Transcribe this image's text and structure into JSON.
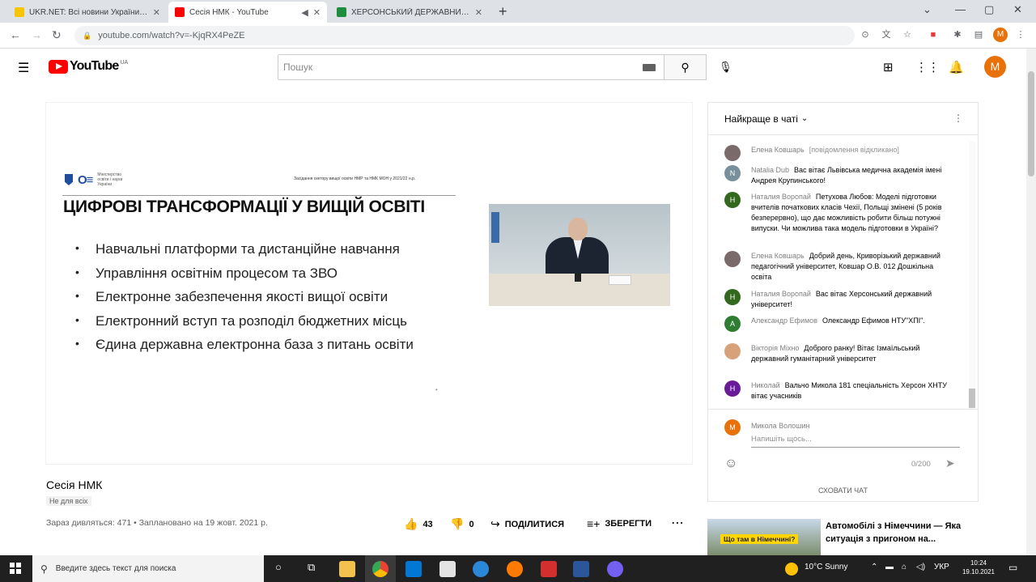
{
  "browser": {
    "tabs": [
      {
        "title": "UKR.NET: Всі новини України, о",
        "favicon_color": "#f7c600"
      },
      {
        "title": "Сесія НМК - YouTube",
        "favicon_color": "#ff0000"
      },
      {
        "title": "ХЕРСОНСЬКИЙ ДЕРЖАВНИЙ УН",
        "favicon_color": "#1e8e3e"
      }
    ],
    "url": "youtube.com/watch?v=-KjqRX4PeZE",
    "profile_initial": "M"
  },
  "youtube": {
    "logo_text": "YouTube",
    "country": "UA",
    "search_placeholder": "Пошук",
    "avatar_initial": "M"
  },
  "slide": {
    "header_note": "Засідання сектору вищої освіти НМР та НМК МОН у 2021/22 н.р.",
    "org_small": "Міністерство освіти і науки України",
    "title": "ЦИФРОВІ ТРАНСФОРМАЦІЇ У ВИЩІЙ ОСВІТІ",
    "bullets": [
      "Навчальні платформи та дистанційне навчання",
      "Управління освітнім процесом та ЗВО",
      "Електронне забезпечення якості вищої освіти",
      "Електронний вступ та розподіл бюджетних місць",
      "Єдина державна електронна база з питань освіти"
    ]
  },
  "video": {
    "title": "Сесія НМК",
    "badge": "Не для всіх",
    "info": "Зараз дивляться: 471 • Заплановано на 19 жовт. 2021 р.",
    "likes": "43",
    "dislikes": "0",
    "share_label": "ПОДІЛИТИСЯ",
    "save_label": "ЗБЕРЕГТИ"
  },
  "chat": {
    "header": "Найкраще в чаті",
    "messages": [
      {
        "author": "Елена Ковшарь",
        "text": "[повідомлення відкликано]",
        "initial": "",
        "color": "#7a6a6a"
      },
      {
        "author": "Natalia Dub",
        "text": "Вас вітає Львівська медична академія імені Андрея Крупинського!",
        "initial": "N",
        "color": "#78909c"
      },
      {
        "author": "Наталия Воропай",
        "text": "Петухова Любов: Моделі підготовки вчителів початкових класів Чехії, Польщі змінені (5 років безперервно), що дає можливість робити більш потужні випуски. Чи можлива така модель підготовки в Україні?",
        "initial": "Н",
        "color": "#33691e"
      },
      {
        "author": "Елена Ковшарь",
        "text": "Добрий день, Криворізький державний педагогічний університет, Ковшар О.В. 012 Дошкільна освіта",
        "initial": "",
        "color": "#7a6a6a"
      },
      {
        "author": "Наталия Воропай",
        "text": "Вас вітає Херсонський державний університет!",
        "initial": "Н",
        "color": "#33691e"
      },
      {
        "author": "Александр Ефимов",
        "text": "Олександр Ефимов НТУ\"ХПІ\".",
        "initial": "А",
        "color": "#2e7d32"
      },
      {
        "author": "Вікторія Міхно",
        "text": "Доброго ранку! Вітає Ізмаїльський державний гуманітарний університет",
        "initial": "",
        "color": "#d7a27a"
      },
      {
        "author": "Николай",
        "text": "Вальчо Микола 181 спеціальність Херсон ХНТУ вітає учасників",
        "initial": "Н",
        "color": "#6a1b9a"
      }
    ],
    "composer_name": "Микола Волошин",
    "composer_initial": "M",
    "composer_placeholder": "Напишіть щось...",
    "char_count": "0/200",
    "hide_label": "СХОВАТИ ЧАТ"
  },
  "recommended": {
    "title": "Автомобілі з Німеччини ― Яка ситуація з пригоном на...",
    "thumb_caption": "Що там в Німеччині?"
  },
  "taskbar": {
    "search_placeholder": "Введите здесь текст для поиска",
    "weather": "10°C  Sunny",
    "lang": "УКР",
    "time": "10:24",
    "date": "19.10.2021"
  }
}
